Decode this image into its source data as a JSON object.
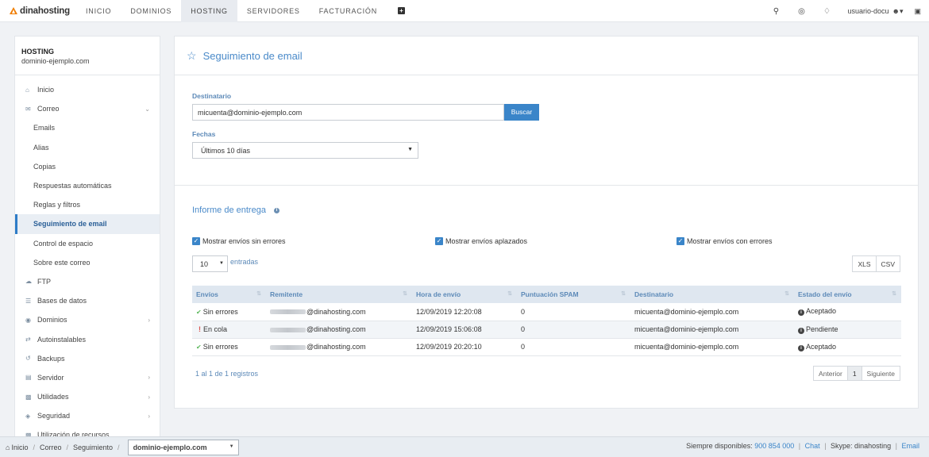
{
  "topnav": {
    "logo": "dinahosting",
    "items": [
      "INICIO",
      "DOMINIOS",
      "HOSTING",
      "SERVIDORES",
      "FACTURACIÓN"
    ],
    "active": "HOSTING",
    "user": "usuario-docu"
  },
  "sidebar": {
    "title": "HOSTING",
    "domain": "dominio-ejemplo.com",
    "items": [
      {
        "label": "Inicio",
        "icon": "home-icon"
      },
      {
        "label": "Correo",
        "icon": "envelope-icon"
      },
      {
        "label": "Emails"
      },
      {
        "label": "Alias"
      },
      {
        "label": "Copias"
      },
      {
        "label": "Respuestas automáticas"
      },
      {
        "label": "Reglas y filtros"
      },
      {
        "label": "Seguimiento de email"
      },
      {
        "label": "Control de espacio"
      },
      {
        "label": "Sobre este correo"
      },
      {
        "label": "FTP",
        "icon": "cloud-upload-icon"
      },
      {
        "label": "Bases de datos",
        "icon": "database-icon"
      },
      {
        "label": "Dominios",
        "icon": "globe-icon"
      },
      {
        "label": "Autoinstalables",
        "icon": "exchange-icon"
      },
      {
        "label": "Backups",
        "icon": "history-icon"
      },
      {
        "label": "Servidor",
        "icon": "server-icon"
      },
      {
        "label": "Utilidades",
        "icon": "gamepad-icon"
      },
      {
        "label": "Seguridad",
        "icon": "shield-icon"
      },
      {
        "label": "Utilización de recursos",
        "icon": "bar-chart-icon"
      }
    ]
  },
  "main": {
    "title": "Seguimiento de email",
    "form": {
      "destinatario_label": "Destinatario",
      "destinatario_value": "micuenta@dominio-ejemplo.com",
      "buscar": "Buscar",
      "fechas_label": "Fechas",
      "fechas_value": "Últimos 10 días"
    },
    "report": {
      "title": "Informe de entrega",
      "checks": [
        "Mostrar envíos sin errores",
        "Mostrar envíos aplazados",
        "Mostrar envíos con errores"
      ],
      "page_len": "10",
      "entradas": "entradas",
      "xls": "XLS",
      "csv": "CSV",
      "columns": [
        "Envíos",
        "Remitente",
        "Hora de envío",
        "Puntuación SPAM",
        "Destinatario",
        "Estado del envío"
      ],
      "rows": [
        {
          "envio": "Sin errores",
          "remitente": "@dinahosting.com",
          "hora": "12/09/2019 12:20:08",
          "spam": "0",
          "dest": "micuenta@dominio-ejemplo.com",
          "estado": "Aceptado"
        },
        {
          "envio": "En cola",
          "remitente": "@dinahosting.com",
          "hora": "12/09/2019 15:06:08",
          "spam": "0",
          "dest": "micuenta@dominio-ejemplo.com",
          "estado": "Pendiente"
        },
        {
          "envio": "Sin errores",
          "remitente": "@dinahosting.com",
          "hora": "12/09/2019 20:20:10",
          "spam": "0",
          "dest": "micuenta@dominio-ejemplo.com",
          "estado": "Aceptado"
        }
      ],
      "info": "1 al 1 de 1 registros",
      "prev": "Anterior",
      "page": "1",
      "next": "Siguiente"
    }
  },
  "bottom": {
    "breadcrumb": [
      "Inicio",
      "Correo",
      "Seguimiento"
    ],
    "domain_select": "dominio-ejemplo.com",
    "contact_prefix": "Siempre disponibles:",
    "phone": "900 854 000",
    "chat": "Chat",
    "skype": "Skype: dinahosting",
    "email": "Email"
  }
}
